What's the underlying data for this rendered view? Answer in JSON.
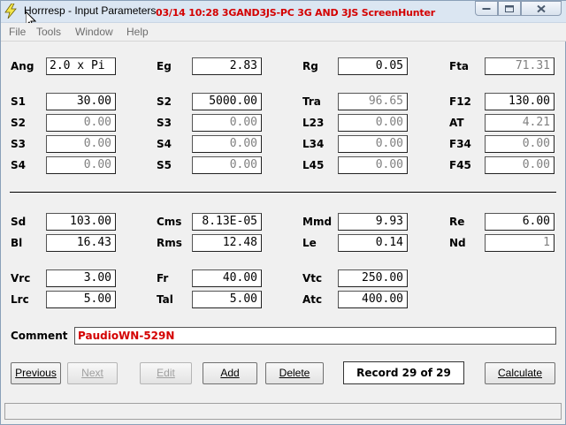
{
  "titlebar": {
    "title": "Horrresp - Input Parameters",
    "overlay": "03/14 10:28 3GAND3JS-PC 3G AND 3JS ScreenHunter"
  },
  "menu": [
    "File",
    "Tools",
    "Window",
    "Help"
  ],
  "params": {
    "ang": {
      "label": "Ang",
      "value": "2.0 x Pi"
    },
    "eg": {
      "label": "Eg",
      "value": "2.83"
    },
    "rg": {
      "label": "Rg",
      "value": "0.05"
    },
    "fta": {
      "label": "Fta",
      "value": "71.31"
    },
    "s1": {
      "label": "S1",
      "value": "30.00"
    },
    "s2a": {
      "label": "S2",
      "value": "5000.00"
    },
    "tra": {
      "label": "Tra",
      "value": "96.65"
    },
    "f12": {
      "label": "F12",
      "value": "130.00"
    },
    "s2": {
      "label": "S2",
      "value": "0.00"
    },
    "s3a": {
      "label": "S3",
      "value": "0.00"
    },
    "l23": {
      "label": "L23",
      "value": "0.00"
    },
    "at": {
      "label": "AT",
      "value": "4.21"
    },
    "s3": {
      "label": "S3",
      "value": "0.00"
    },
    "s4a": {
      "label": "S4",
      "value": "0.00"
    },
    "l34": {
      "label": "L34",
      "value": "0.00"
    },
    "f34": {
      "label": "F34",
      "value": "0.00"
    },
    "s4": {
      "label": "S4",
      "value": "0.00"
    },
    "s5": {
      "label": "S5",
      "value": "0.00"
    },
    "l45": {
      "label": "L45",
      "value": "0.00"
    },
    "f45": {
      "label": "F45",
      "value": "0.00"
    },
    "sd": {
      "label": "Sd",
      "value": "103.00"
    },
    "cms": {
      "label": "Cms",
      "value": "8.13E-05"
    },
    "mmd": {
      "label": "Mmd",
      "value": "9.93"
    },
    "re": {
      "label": "Re",
      "value": "6.00"
    },
    "bl": {
      "label": "Bl",
      "value": "16.43"
    },
    "rms": {
      "label": "Rms",
      "value": "12.48"
    },
    "le": {
      "label": "Le",
      "value": "0.14"
    },
    "nd": {
      "label": "Nd",
      "value": "1"
    },
    "vrc": {
      "label": "Vrc",
      "value": "3.00"
    },
    "fr": {
      "label": "Fr",
      "value": "40.00"
    },
    "vtc": {
      "label": "Vtc",
      "value": "250.00"
    },
    "lrc": {
      "label": "Lrc",
      "value": "5.00"
    },
    "tal": {
      "label": "Tal",
      "value": "5.00"
    },
    "atc": {
      "label": "Atc",
      "value": "400.00"
    }
  },
  "comment": {
    "label": "Comment",
    "value": "PaudioWN-529N"
  },
  "buttons": {
    "previous": "Previous",
    "next": "Next",
    "edit": "Edit",
    "add": "Add",
    "delete": "Delete",
    "calculate": "Calculate"
  },
  "record": "Record 29 of 29",
  "icons": {
    "app": "lightning-icon",
    "minimize": "minimize-icon",
    "maximize": "maximize-icon",
    "close": "close-icon",
    "cursor": "mouse-pointer-icon"
  },
  "colors": {
    "overlay_text": "#d40000",
    "comment_text": "#d40000",
    "titlebar": "#dbe6f2"
  }
}
